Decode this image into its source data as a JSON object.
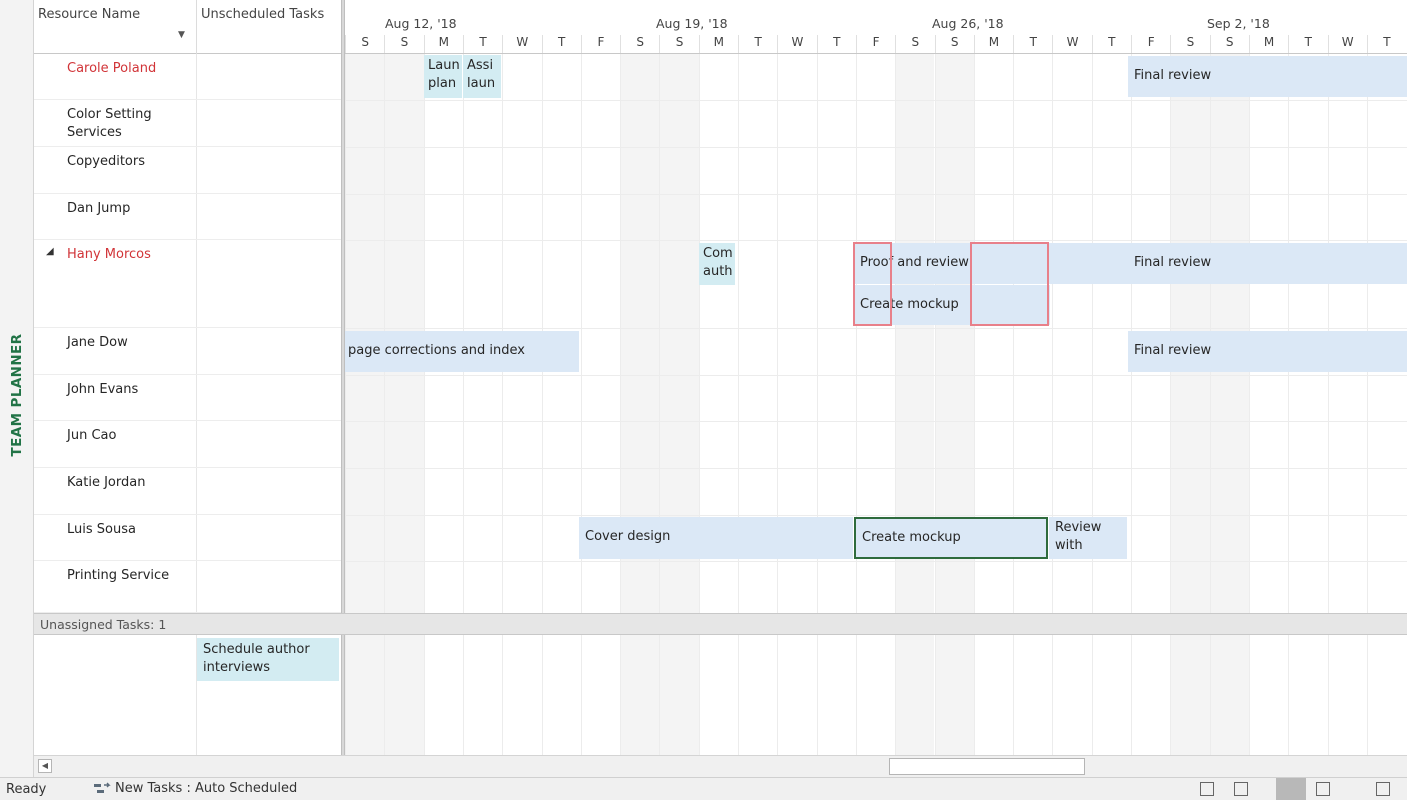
{
  "side_label": "TEAM PLANNER",
  "columns": {
    "resource_name": "Resource Name",
    "unscheduled_tasks": "Unscheduled Tasks"
  },
  "weeks": [
    "Aug 12, '18",
    "Aug 19, '18",
    "Aug 26, '18",
    "Sep 2, '18"
  ],
  "days": [
    "S",
    "S",
    "M",
    "T",
    "W",
    "T",
    "F",
    "S",
    "S",
    "M",
    "T",
    "W",
    "T",
    "F",
    "S",
    "S",
    "M",
    "T",
    "W",
    "T",
    "F",
    "S",
    "S",
    "M",
    "T",
    "W",
    "T"
  ],
  "resources": [
    {
      "name": "Carole Poland",
      "overallocated": true
    },
    {
      "name": "Color Setting Services",
      "overallocated": false
    },
    {
      "name": "Copyeditors",
      "overallocated": false
    },
    {
      "name": "Dan Jump",
      "overallocated": false
    },
    {
      "name": "Hany Morcos",
      "overallocated": true,
      "expanded": true
    },
    {
      "name": "Jane Dow",
      "overallocated": false
    },
    {
      "name": "John Evans",
      "overallocated": false
    },
    {
      "name": "Jun Cao",
      "overallocated": false
    },
    {
      "name": "Katie Jordan",
      "overallocated": false
    },
    {
      "name": "Luis Sousa",
      "overallocated": false
    },
    {
      "name": "Printing Service",
      "overallocated": false
    }
  ],
  "tasks": {
    "carole_launch": "Laun plan",
    "carole_assign": "Assi laun",
    "carole_final": "Final review",
    "hany_comm": "Com auth",
    "hany_proof": "Proof and review",
    "hany_mockup": "Create mockup",
    "hany_final": "Final review",
    "jane_page": "page corrections and index",
    "jane_final": "Final review",
    "luis_cover": "Cover design",
    "luis_mockup": "Create mockup",
    "luis_review": "Review with"
  },
  "unassigned": {
    "label": "Unassigned Tasks: 1",
    "task": "Schedule author interviews"
  },
  "status": {
    "ready": "Ready",
    "new_tasks": "New Tasks : Auto Scheduled"
  },
  "icons": {
    "new_tasks": "auto-schedule-icon",
    "views": [
      "normal-view-icon",
      "gantt-view-icon",
      "team-planner-view-icon",
      "resource-sheet-view-icon",
      "report-view-icon"
    ]
  },
  "colors": {
    "accent_green": "#217346",
    "overallocated_red": "#d13438",
    "task_bar": "#dbe8f6",
    "task_bar_teal": "#d3ecf2"
  }
}
